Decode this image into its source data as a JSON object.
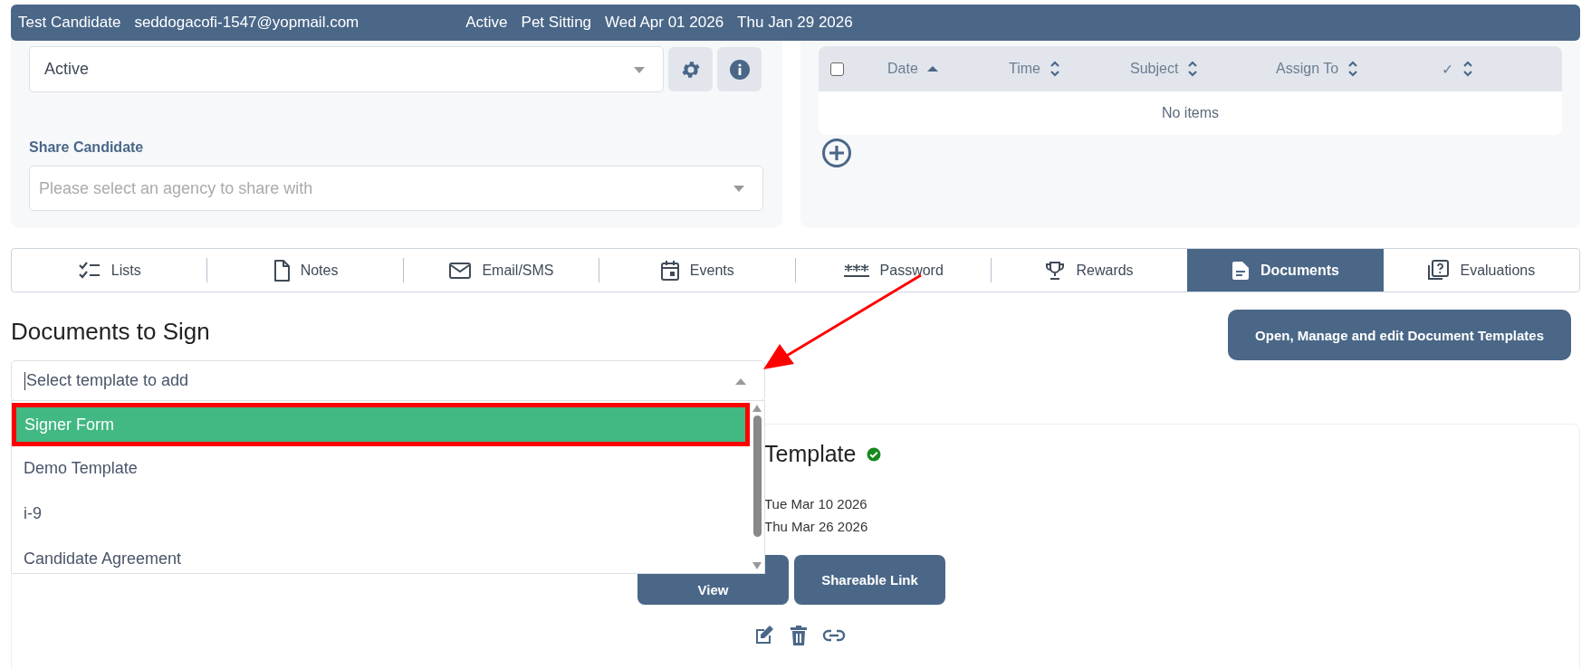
{
  "header_bar": {
    "name": "Test Candidate",
    "email": "seddogacofi-1547@yopmail.com",
    "status": "Active",
    "service": "Pet Sitting",
    "date_1": "Wed Apr 01 2026",
    "date_2": "Thu Jan 29 2026"
  },
  "status_select": {
    "value": "Active"
  },
  "share_candidate": {
    "label": "Share Candidate",
    "placeholder": "Please select an agency to share with"
  },
  "events_table": {
    "checked": false,
    "columns": [
      {
        "label": "Date",
        "sorted": true
      },
      {
        "label": "Time",
        "sorted": false
      },
      {
        "label": "Subject",
        "sorted": false
      },
      {
        "label": "Assign To",
        "sorted": false
      },
      {
        "label": "✓",
        "sorted": false
      }
    ],
    "empty_text": "No items"
  },
  "tabs": [
    {
      "label": "Lists",
      "selected": false
    },
    {
      "label": "Notes",
      "selected": false
    },
    {
      "label": "Email/SMS",
      "selected": false
    },
    {
      "label": "Events",
      "selected": false
    },
    {
      "label": "Password",
      "selected": false
    },
    {
      "label": "Rewards",
      "selected": false
    },
    {
      "label": "Documents",
      "selected": true
    },
    {
      "label": "Evaluations",
      "selected": false
    }
  ],
  "documents": {
    "title": "Documents to Sign",
    "templates_button": "Open, Manage and edit Document Templates",
    "template_select": {
      "placeholder": "Select template to add",
      "expanded": true,
      "options": [
        {
          "label": "Signer Form",
          "selected": true
        },
        {
          "label": "Demo Template",
          "selected": false
        },
        {
          "label": "i-9",
          "selected": false
        },
        {
          "label": "Candidate Agreement",
          "selected": false
        }
      ]
    },
    "card": {
      "title": "Template",
      "signed": true,
      "dates": [
        "Tue Mar 10 2026",
        "Thu Mar 26 2026"
      ],
      "buttons": [
        "View",
        "Shareable Link"
      ]
    }
  }
}
